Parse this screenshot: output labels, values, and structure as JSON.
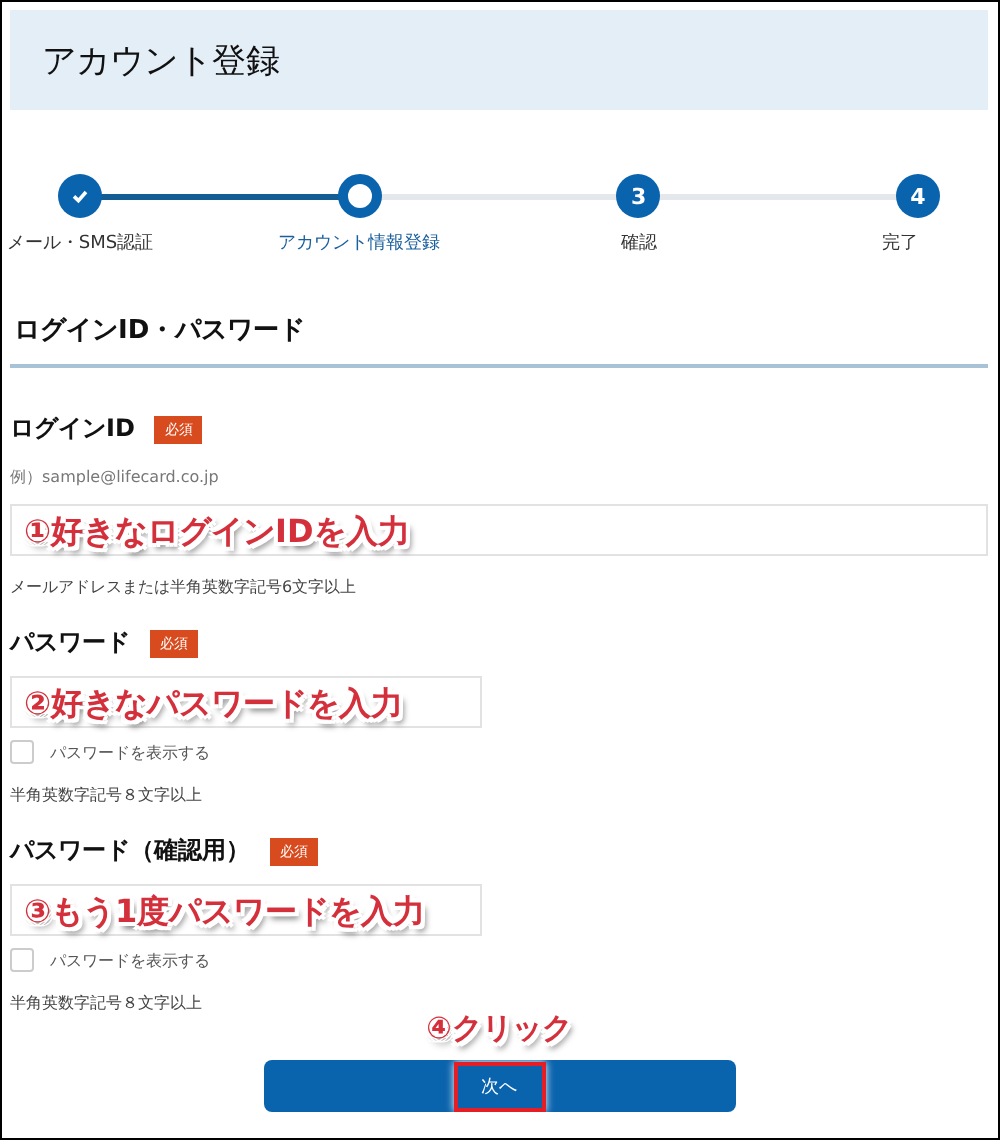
{
  "header": {
    "title": "アカウント登録"
  },
  "steps": [
    {
      "label": "メール・SMS認証",
      "completed": true,
      "selected": false
    },
    {
      "label": "アカウント情報登録",
      "completed": false,
      "selected": true
    },
    {
      "label": "確認",
      "completed": false,
      "selected": false,
      "number": "3"
    },
    {
      "label": "完了",
      "completed": false,
      "selected": false,
      "number": "4"
    }
  ],
  "section": {
    "title": "ログインID・パスワード"
  },
  "fields": [
    {
      "label": "ログインID",
      "badge": "必須",
      "example": "例）sample@lifecard.co.jp",
      "kind": "full",
      "annotation": "①好きなログインIDを入力",
      "hint": "メールアドレスまたは半角英数字記号6文字以上"
    },
    {
      "label": "パスワード",
      "badge": "必須",
      "kind": "half",
      "annotation": "②好きなパスワードを入力",
      "show_password": {
        "label": "パスワードを表示する",
        "checked": false
      },
      "hint": "半角英数字記号８文字以上"
    },
    {
      "label": "パスワード（確認用）",
      "badge": "必須",
      "kind": "half",
      "annotation": "③もう1度パスワードを入力",
      "show_password": {
        "label": "パスワードを表示する",
        "checked": false
      },
      "hint": "半角英数字記号８文字以上"
    }
  ],
  "next_button": {
    "label": "次へ",
    "annotation": "④クリック",
    "highlighted": true
  }
}
